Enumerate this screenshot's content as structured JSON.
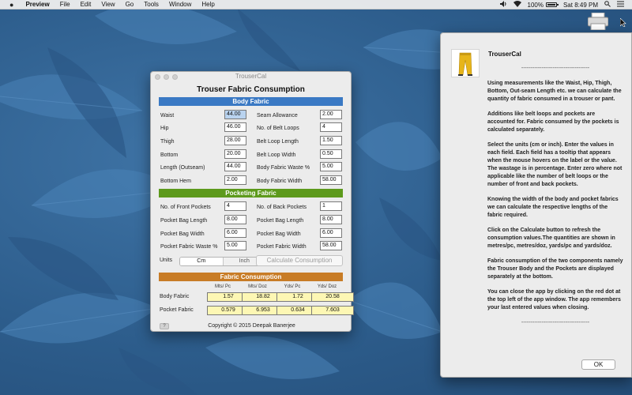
{
  "menubar": {
    "app_name": "Preview",
    "items": [
      "File",
      "Edit",
      "View",
      "Go",
      "Tools",
      "Window",
      "Help"
    ],
    "battery": "100%",
    "clock": "Sat 8:49 PM"
  },
  "app": {
    "window_title": "TrouserCal",
    "heading": "Trouser Fabric Consumption",
    "body_fabric": {
      "header": "Body Fabric",
      "left": [
        {
          "label": "Waist",
          "value": "44.00"
        },
        {
          "label": "Hip",
          "value": "46.00"
        },
        {
          "label": "Thigh",
          "value": "28.00"
        },
        {
          "label": "Bottom",
          "value": "20.00"
        },
        {
          "label": "Length (Outseam)",
          "value": "44.00"
        },
        {
          "label": "Bottom Hem",
          "value": "2.00"
        }
      ],
      "right": [
        {
          "label": "Seam Allowance",
          "value": "2.00"
        },
        {
          "label": "No. of Belt Loops",
          "value": "4"
        },
        {
          "label": "Belt Loop Length",
          "value": "1.50"
        },
        {
          "label": "Belt Loop Width",
          "value": "0.50"
        },
        {
          "label": "Body Fabric Waste %",
          "value": "5.00"
        },
        {
          "label": "Body Fabric Width",
          "value": "58.00"
        }
      ]
    },
    "pocketing_fabric": {
      "header": "Pocketing Fabric",
      "left": [
        {
          "label": "No. of Front Pockets",
          "value": "4"
        },
        {
          "label": "Pocket Bag Length",
          "value": "8.00"
        },
        {
          "label": "Pocket Bag Width",
          "value": "6.00"
        },
        {
          "label": "Pocket Fabric Waste %",
          "value": "5.00"
        }
      ],
      "right": [
        {
          "label": "No. of Back Pockets",
          "value": "1"
        },
        {
          "label": "Pocket Bag Length",
          "value": "8.00"
        },
        {
          "label": "Pocket Bag Width",
          "value": "6.00"
        },
        {
          "label": "Pocket Fabric Width",
          "value": "58.00"
        }
      ]
    },
    "units": {
      "label": "Units",
      "options": [
        "Cm",
        "Inch"
      ],
      "selected": "Cm"
    },
    "calculate_button": "Calculate Consumption",
    "consumption": {
      "header": "Fabric Consumption",
      "columns": [
        "Mts/ Pc",
        "Mts/ Doz",
        "Yds/ Pc",
        "Yds/ Doz"
      ],
      "rows": [
        {
          "label": "Body Fabric",
          "values": [
            "1.57",
            "18.82",
            "1.72",
            "20.58"
          ]
        },
        {
          "label": "Pocket Fabric",
          "values": [
            "0.579",
            "6.953",
            "0.634",
            "7.603"
          ]
        }
      ]
    },
    "help_button": "?",
    "copyright": "Copyright © 2015  Deepak Banerjee",
    "colors": {
      "body_bar": "#3a79c4",
      "pocket_bar": "#5d9a1c",
      "consumption_bar": "#c87c26"
    }
  },
  "help": {
    "title": "TrouserCal",
    "separator": "-------------------------------------",
    "paragraphs": [
      "Using measurements like the Waist, Hip, Thigh, Bottom, Out-seam Length etc. we can calculate the quantity of fabric consumed in a trouser or pant.",
      "Additions like belt loops and pockets are accounted for. Fabric consumed by the pockets is calculated separately.",
      "Select the units (cm or inch). Enter the values in each field. Each field has a tooltip that appears when the mouse hovers on the label or the value. The wastage is in percentage. Enter zero where not applicable like the number of belt loops or the number of front and back pockets.",
      "Knowing the width of the body and pocket fabrics we can calculate the respective lengths of the fabric required.",
      "Click on the Calculate button to refresh the consumption values.The quantities are shown in metres/pc, metres/doz, yards/pc and yards/doz.",
      "Fabric consumption of the two components namely the Trouser Body and the Pockets are displayed separately at the bottom.",
      "You can close the app by clicking on the red dot at the top left of the app window. The app remembers your last entered values when closing."
    ],
    "ok_button": "OK"
  }
}
